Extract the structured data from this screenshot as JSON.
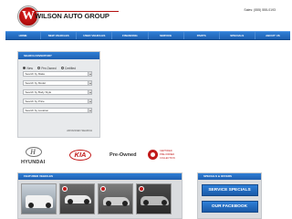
{
  "header": {
    "logo_text": "WILSON AUTO GROUP",
    "logo_initial": "W",
    "sales": "Sales: (555) 555-0193"
  },
  "nav": {
    "items": [
      "HOME",
      "NEW VEHICLES",
      "USED VEHICLES",
      "FINANCING",
      "SERVICE",
      "PARTS",
      "SPECIALS",
      "ABOUT US"
    ]
  },
  "search": {
    "title": "SEARCH INVENTORY",
    "radios": [
      {
        "label": "New",
        "selected": true
      },
      {
        "label": "Pre-Owned",
        "selected": false
      },
      {
        "label": "Certified",
        "selected": false
      }
    ],
    "selects": [
      "Search by Make",
      "Search by Model",
      "Search by Body Style",
      "Search by Price",
      "Search by Location"
    ],
    "advanced": "ADVANCED SEARCH"
  },
  "brands": {
    "hyundai": "HYUNDAI",
    "kia": "KIA",
    "preowned": "Pre-Owned",
    "certified_lines": [
      "CERTIFIED",
      "PRE-OWNED",
      "COLLECTION"
    ]
  },
  "featured": {
    "title": "FEATURED VEHICLES"
  },
  "specials": {
    "title": "SPECIALS & OFFERS",
    "buttons": [
      "SERVICE SPECIALS",
      "OUR FACEBOOK"
    ]
  },
  "colors": {
    "nav_blue": "#1e5fb0",
    "brand_red": "#c11a1a"
  }
}
